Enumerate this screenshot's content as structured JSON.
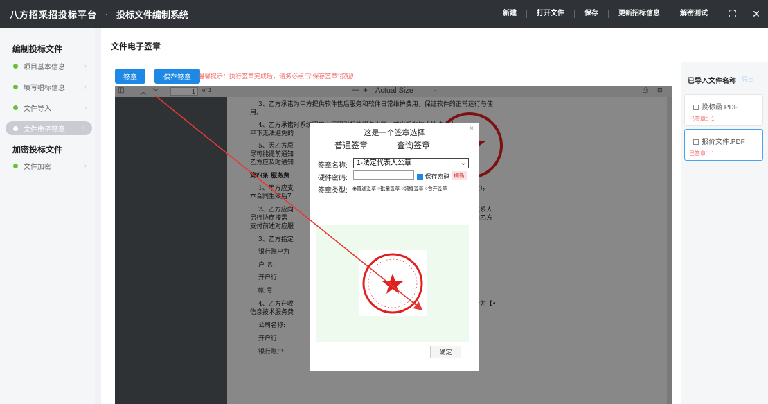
{
  "header": {
    "brand": "八方招采招投标平台",
    "separator": "·",
    "system_title": "投标文件编制系统",
    "menu": [
      "新建",
      "打开文件",
      "保存",
      "更新招标信息",
      "解密测试"
    ],
    "window_controls": [
      "—",
      "⛶",
      "✕"
    ]
  },
  "sidebar": {
    "section1_title": "编制投标文件",
    "section1_items": [
      {
        "label": "项目基本信息"
      },
      {
        "label": "填写唱标信息"
      },
      {
        "label": "文件导入"
      },
      {
        "label": "文件电子签章"
      }
    ],
    "section2_title": "加密投标文件",
    "section2_items": [
      {
        "label": "文件加密"
      }
    ]
  },
  "main": {
    "page_title": "文件电子签章",
    "sign_button": "签章",
    "save_sign_button": "保存签章",
    "tip": "温馨提示：执行签章完成后，请务必点击\"保存签章\"按钮!"
  },
  "viewer": {
    "page_number": "1",
    "page_count": "of 1",
    "zoom_minus": "—",
    "zoom_plus": "+",
    "zoom": "Actual Size",
    "doc_lines": [
      "3、乙方承诺为甲方提供软件售后服务和软件日常维护费用，保证软件的正常运行与使",
      "用。",
      "4、乙方承诺对系统因甲方原因引起的服务中断，若出现非技术性技术水",
      "平下无法避免的",
      "5、因乙方原",
      "尽可能提前通知",
      "乙方应及时通知",
      "第四条  服务费",
      "1、甲方应支",
      "本合同生效后7",
      "2、乙方应向",
      "另行协商按需",
      "支付前述对应服",
      "3、乙方指定",
      "银行账户为",
      "户  名:",
      "开户行:",
      "帐  号:",
      "4、乙方在收",
      "信息技术服务费",
      "公司名称:",
      "开户行:",
      "银行账户:"
    ],
    "doc_right_lines": [
      "登)，",
      "联系人",
      "向乙方",
      "行为【•"
    ]
  },
  "dialog": {
    "title": "这是一个签章选择",
    "close": "×",
    "tabs": [
      "普通签章",
      "查询签章"
    ],
    "seal_name_label": "签章名称:",
    "seal_name_value": "1-法定代表人公章",
    "password_label": "硬件密码:",
    "save_password_label": "保存密码",
    "refresh_label": "刷新",
    "seal_type_label": "签章类型:",
    "seal_types": [
      "普通签章",
      "批量签章",
      "骑缝签章",
      "合并签章"
    ],
    "confirm_button": "确定"
  },
  "right_panel": {
    "title": "已导入文件名称",
    "export_label": "导出",
    "files": [
      {
        "name": "投标函.PDF",
        "status": "已签章：1"
      },
      {
        "name": "报价文件.PDF",
        "status": "已签章：1"
      }
    ]
  },
  "colors": {
    "topbar": "#2f3338",
    "primary": "#1e88e5",
    "success_dot": "#67c23a",
    "warning_text": "#f56c6c",
    "stamp_red": "#e02020",
    "arrow": "#e53935"
  }
}
